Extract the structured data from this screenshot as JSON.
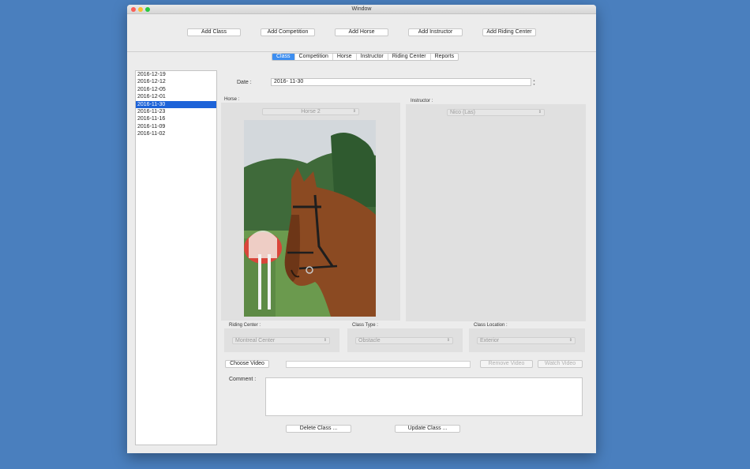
{
  "window": {
    "title": "Window"
  },
  "toolbar": {
    "add_class": "Add Class",
    "add_competition": "Add Competition",
    "add_horse": "Add Horse",
    "add_instructor": "Add Instructor",
    "add_riding_center": "Add Riding Center"
  },
  "tabs": [
    "Class",
    "Competition",
    "Horse",
    "Instructor",
    "Riding Center",
    "Reports"
  ],
  "active_tab": "Class",
  "class_dates": [
    "2016-12-19",
    "2016-12-12",
    "2016-12-05",
    "2016-12-01",
    "2016-11-30",
    "2016-11-23",
    "2016-11-16",
    "2016-11-09",
    "2016-11-02"
  ],
  "selected_date": "2016-11-30",
  "form": {
    "date_label": "Date :",
    "date_value": "2016- 11-30",
    "horse_label": "Horse :",
    "horse_value": "Horse 2",
    "instructor_label": "Instructor :",
    "instructor_value": "Nico (Las)",
    "riding_center_label": "Riding Center :",
    "riding_center_value": "Montreal Center",
    "class_type_label": "Class Type :",
    "class_type_value": "Obstacle",
    "class_location_label": "Class Location :",
    "class_location_value": "Exterior",
    "choose_video": "Choose Video",
    "remove_video": "Remove Video",
    "watch_video": "Watch Video",
    "comment_label": "Comment :",
    "delete_class": "Delete Class ...",
    "update_class": "Update Class ..."
  },
  "icons": {
    "stepper": "stepper-arrows-icon",
    "popup": "popup-arrows-icon"
  },
  "colors": {
    "accent": "#3d8ef0",
    "selection": "#1d63d8",
    "desktop": "#4a7fbe"
  }
}
